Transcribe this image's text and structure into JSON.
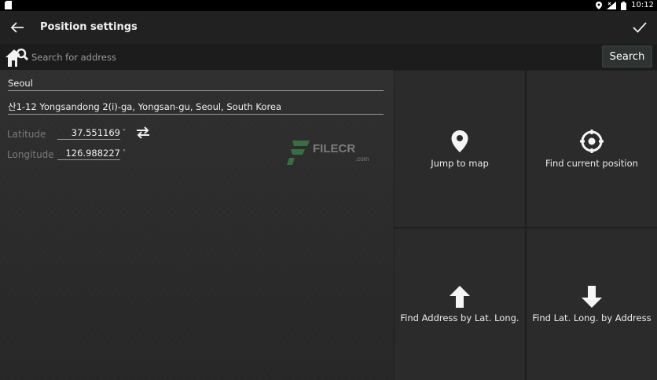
{
  "status_bar": {
    "time": "10:12"
  },
  "app_bar": {
    "title": "Position settings"
  },
  "search": {
    "placeholder": "Search for address",
    "button_label": "Search"
  },
  "location": {
    "name": "Seoul",
    "address": "산1-12 Yongsandong 2(i)-ga, Yongsan-gu, Seoul, South Korea",
    "latitude_label": "Latitude",
    "latitude_value": "37.551169",
    "longitude_label": "Longitude",
    "longitude_value": "126.988227",
    "degree_symbol": "°"
  },
  "watermark": {
    "text": "FILECR",
    "sub": ".com"
  },
  "actions": [
    {
      "label": "Jump to map",
      "icon": "map-pin-icon"
    },
    {
      "label": "Find current position",
      "icon": "crosshair-icon"
    },
    {
      "label": "Find Address by Lat. Long.",
      "icon": "arrow-up-icon"
    },
    {
      "label": "Find Lat. Long. by Address",
      "icon": "arrow-down-icon"
    }
  ],
  "colors": {
    "background": "#2a2a2a",
    "app_bar": "#212121",
    "tile": "#2b2b2b"
  }
}
